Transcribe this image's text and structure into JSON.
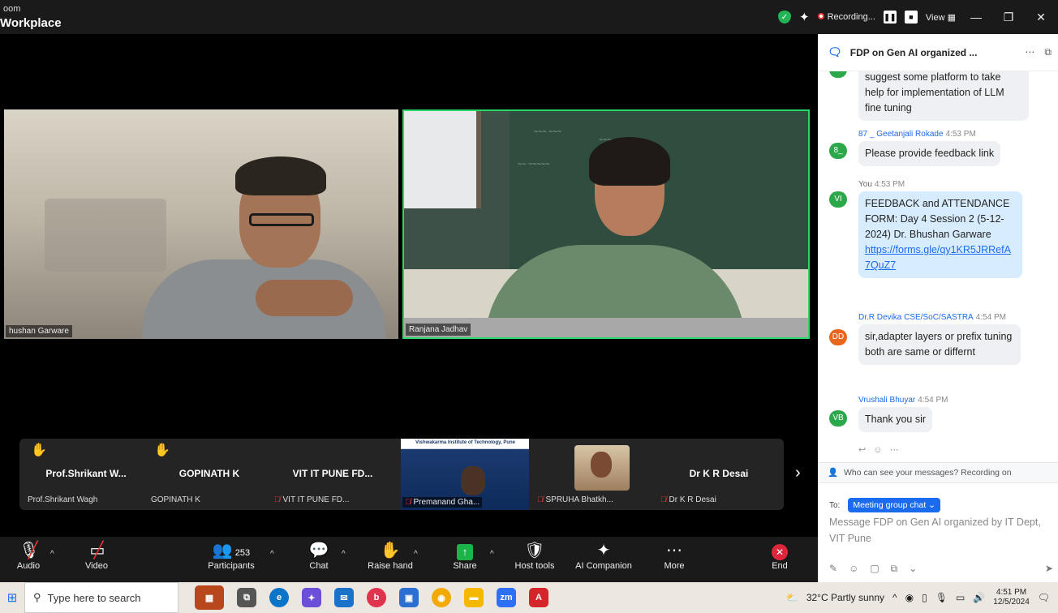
{
  "window": {
    "app_title_line1": "oom",
    "app_title_line2": "Workplace",
    "recording_label": "Recording...",
    "view_label": "View",
    "minimize": "—",
    "maximize": "❐",
    "close": "✕"
  },
  "videos": {
    "tile1_name": "hushan Garware",
    "tile2_name": "Ranjana Jadhav"
  },
  "participants": [
    {
      "name": "Prof.Shrikant  W...",
      "label": "Prof.Shrikant Wagh",
      "hand": true,
      "muted": false
    },
    {
      "name": "GOPINATH K",
      "label": "GOPINATH K",
      "hand": true,
      "muted": false
    },
    {
      "name": "VIT IT PUNE FD...",
      "label": "VIT IT PUNE FD...",
      "hand": false,
      "muted": true
    },
    {
      "name": "",
      "label": "Premanand Gha...",
      "hand": false,
      "muted": true,
      "video": true,
      "video_header": "Vishwakarma Institute of Technology, Pune"
    },
    {
      "name": "",
      "label": "SPRUHA Bhatkh...",
      "hand": false,
      "muted": true
    },
    {
      "name": "Dr K R Desai",
      "label": "Dr K R Desai",
      "hand": false,
      "muted": true
    }
  ],
  "toolbar": {
    "audio": "Audio",
    "video": "Video",
    "participants": "Participants",
    "participants_count": "253",
    "chat": "Chat",
    "raise_hand": "Raise hand",
    "share": "Share",
    "host_tools": "Host tools",
    "ai_companion": "AI Companion",
    "more": "More",
    "end": "End"
  },
  "chat": {
    "title": "FDP on Gen AI  organized ...",
    "messages": [
      {
        "continued": true,
        "text": "suggest some platform to take help for implementation of LLM fine tuning"
      },
      {
        "sender": "87 _ Geetanjali Rokade",
        "time": "4:53 PM",
        "avatar": "8_",
        "avatar_color": "#2aa84a",
        "text": "Please provide feedback link"
      },
      {
        "sender": "You",
        "time": "4:53 PM",
        "avatar": "VI",
        "avatar_color": "#2aa84a",
        "mine": true,
        "text": "FEEDBACK and ATTENDANCE FORM: Day 4 Session 2   (5-12-2024) Dr. Bhushan Garware",
        "link": "https://forms.gle/qy1KR5JRRefA7QuZ7"
      },
      {
        "sender": "Dr.R Devika CSE/SoC/SASTRA",
        "time": "4:54 PM",
        "avatar": "DD",
        "avatar_color": "#e8671c",
        "text": "sir,adapter layers or prefix tuning both are same or differnt"
      },
      {
        "sender": "Vrushali Bhuyar",
        "time": "4:54 PM",
        "avatar": "VB",
        "avatar_color": "#2aa84a",
        "text": "Thank you sir"
      }
    ],
    "privacy_note": "Who can see your messages? Recording on",
    "to_label": "To:",
    "to_target": "Meeting group chat",
    "composer_placeholder": "Message  FDP on Gen AI  organized by IT Dept, VIT Pune"
  },
  "taskbar": {
    "search_placeholder": "Type here to search",
    "weather": "32°C  Partly sunny",
    "time": "4:51 PM",
    "date": "12/5/2024"
  },
  "colors": {
    "accent": "#1b6bf0",
    "active_speaker": "#2bd66a",
    "end_red": "#e0263b",
    "share_green": "#1db34b"
  }
}
